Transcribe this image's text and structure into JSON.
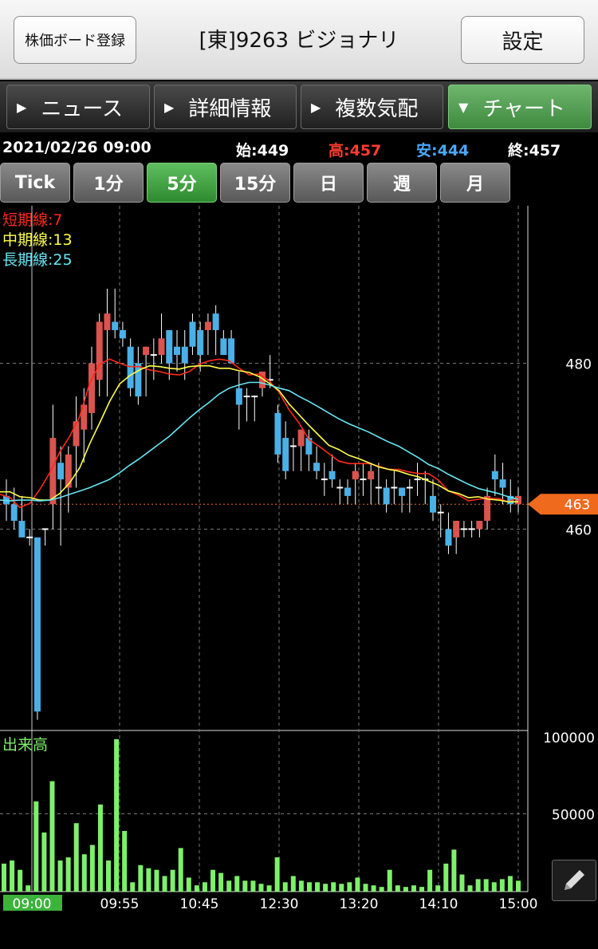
{
  "header": {
    "register_label": "株価ボード登録",
    "title": "[東]9263 ビジョナリ",
    "settings_label": "設定"
  },
  "nav": {
    "tabs": [
      {
        "label": "ニュース",
        "arrow": "▶",
        "active": false
      },
      {
        "label": "詳細情報",
        "arrow": "▶",
        "active": false
      },
      {
        "label": "複数気配",
        "arrow": "▶",
        "active": false
      },
      {
        "label": "チャート",
        "arrow": "▼",
        "active": true
      }
    ]
  },
  "info": {
    "datetime": "2021/02/26 09:00",
    "open": "始:449",
    "high": "高:457",
    "low": "安:444",
    "close": "終:457"
  },
  "periods": [
    {
      "label": "Tick",
      "active": false
    },
    {
      "label": "1分",
      "active": false
    },
    {
      "label": "5分",
      "active": true
    },
    {
      "label": "15分",
      "active": false
    },
    {
      "label": "日",
      "active": false
    },
    {
      "label": "週",
      "active": false
    },
    {
      "label": "月",
      "active": false
    }
  ],
  "colors": {
    "up": "#d9534f",
    "down": "#4ab0e6",
    "short_ma": "#ff2a1a",
    "mid_ma": "#ffff4a",
    "long_ma": "#66e6f2",
    "volume": "#7ef06a",
    "current_price_tag": "#f06a1e"
  },
  "chart": {
    "legend": {
      "short": "短期線:7",
      "mid": "中期線:13",
      "long": "長期線:25"
    },
    "volume_label": "出来高",
    "current_price": "463",
    "pencil_icon": "pencil-icon"
  },
  "chart_data": {
    "type": "candlestick",
    "price_axis": {
      "ticks": [
        480,
        460
      ],
      "range": [
        436,
        499
      ]
    },
    "volume_axis": {
      "ticks": [
        100000,
        50000
      ],
      "range": [
        0,
        100000
      ]
    },
    "time_labels": [
      "09:00",
      "09:55",
      "10:45",
      "12:30",
      "13:20",
      "14:10",
      "15:00"
    ],
    "series": [
      {
        "name": "短期線:7",
        "values": [
          464.2,
          463.8,
          462.6,
          463.1,
          464.8,
          466.8,
          469.3,
          471.2,
          473.6,
          477.6,
          479.9,
          480.5,
          480.0,
          479.6,
          479.6,
          479.2,
          479.0,
          478.7,
          478.6,
          479.0,
          479.9,
          480.3,
          480.5,
          480.3,
          479.4,
          478.6,
          478.7,
          477.9,
          476.5,
          474.4,
          472.8,
          470.8,
          470.0,
          469.1,
          468.2,
          467.9,
          467.9,
          467.9,
          467.6,
          467.2,
          467.2,
          466.9,
          466.7,
          466.7,
          465.9,
          464.6,
          464.1,
          463.4,
          463.6,
          463.7,
          463.7,
          463.3,
          463.8
        ]
      },
      {
        "name": "中期線:13",
        "values": [
          464.5,
          464.5,
          463.9,
          463.8,
          463.5,
          463.5,
          464.3,
          465.6,
          467.4,
          470.3,
          472.8,
          475.4,
          477.5,
          478.5,
          479.2,
          479.7,
          479.6,
          479.4,
          479.3,
          479.6,
          479.7,
          479.7,
          479.4,
          479.4,
          479.1,
          478.9,
          478.4,
          477.6,
          476.7,
          475.1,
          473.8,
          472.5,
          471.3,
          470.1,
          469.6,
          468.9,
          468.5,
          468.0,
          467.5,
          467.2,
          467.0,
          466.6,
          466.3,
          465.8,
          465.3,
          464.6,
          464.3,
          463.8,
          463.9,
          463.6,
          463.5,
          463.3,
          463.3
        ]
      },
      {
        "name": "長期線:25",
        "values": [
          463.5,
          463.4,
          463.5,
          463.5,
          463.4,
          463.5,
          463.8,
          464.2,
          464.6,
          465.0,
          465.5,
          466.0,
          466.8,
          467.7,
          468.5,
          469.4,
          470.3,
          471.2,
          472.3,
          473.4,
          474.4,
          475.3,
          476.3,
          477.0,
          477.4,
          477.7,
          477.7,
          477.4,
          477.0,
          476.7,
          476.0,
          475.4,
          474.7,
          474.0,
          473.3,
          472.7,
          472.2,
          471.7,
          471.1,
          470.5,
          470.0,
          469.3,
          468.6,
          467.8,
          467.3,
          466.6,
          466.0,
          465.4,
          464.9,
          464.6,
          464.3,
          463.9,
          463.6
        ]
      },
      {
        "name": "出来高",
        "values": [
          18000,
          20000,
          14000,
          4000,
          58000,
          38000,
          71000,
          20000,
          22000,
          44000,
          24000,
          30000,
          56000,
          20000,
          98000,
          39000,
          6000,
          17000,
          15000,
          14000,
          10000,
          14000,
          28000,
          9000,
          4000,
          6000,
          14000,
          12000,
          7000,
          10000,
          7000,
          7000,
          5000,
          4000,
          22000,
          6000,
          10000,
          7000,
          6000,
          6000,
          5000,
          6000,
          5000,
          6000,
          9000,
          5000,
          4000,
          3000,
          14000,
          4000,
          3000,
          4000,
          3000,
          14000,
          4000,
          18000,
          27000,
          11000,
          4000,
          8000,
          8000,
          6000,
          8000,
          10000,
          7000
        ]
      }
    ],
    "candles": [
      [
        464,
        466,
        461,
        463
      ],
      [
        463,
        465,
        460,
        461
      ],
      [
        461,
        464,
        459,
        459
      ],
      [
        459,
        460,
        458,
        459
      ],
      [
        459,
        459,
        437,
        438
      ],
      [
        460,
        460,
        458,
        460
      ],
      [
        463,
        475,
        460,
        471
      ],
      [
        468,
        470,
        458,
        466
      ],
      [
        465,
        470,
        462,
        469
      ],
      [
        470,
        476,
        465,
        473
      ],
      [
        472,
        477,
        468,
        475
      ],
      [
        474,
        482,
        472,
        480
      ],
      [
        478,
        486,
        476,
        485
      ],
      [
        484,
        489,
        476,
        486
      ],
      [
        485,
        489,
        483,
        484
      ],
      [
        484,
        485,
        482,
        483
      ],
      [
        482,
        483,
        476,
        477
      ],
      [
        480,
        482,
        475,
        476
      ],
      [
        481,
        482,
        476,
        482
      ],
      [
        481,
        483,
        478,
        481
      ],
      [
        481,
        486,
        480,
        483
      ],
      [
        484,
        484,
        478,
        480
      ],
      [
        482,
        484,
        479,
        481
      ],
      [
        482,
        484,
        478,
        480
      ],
      [
        485,
        486,
        481,
        482
      ],
      [
        484,
        485,
        479,
        481
      ],
      [
        484,
        486,
        481,
        485
      ],
      [
        486,
        487,
        481,
        484
      ],
      [
        483,
        484,
        481,
        481
      ],
      [
        483,
        484,
        481,
        480
      ],
      [
        477,
        479,
        472,
        475
      ],
      [
        476,
        477,
        473,
        476
      ],
      [
        476,
        476,
        473,
        476
      ],
      [
        477,
        479,
        476,
        479
      ],
      [
        478,
        481,
        477,
        478
      ],
      [
        474,
        475,
        468,
        469
      ],
      [
        471,
        473,
        466,
        467
      ],
      [
        470,
        471,
        467,
        470
      ],
      [
        470,
        472,
        467,
        472
      ],
      [
        471,
        472,
        467,
        469
      ],
      [
        468,
        470,
        466,
        467
      ],
      [
        466,
        468,
        464,
        466
      ],
      [
        467,
        469,
        465,
        466
      ],
      [
        465,
        466,
        463,
        465
      ],
      [
        465,
        466,
        463,
        464
      ],
      [
        466,
        468,
        463,
        467
      ],
      [
        466,
        468,
        464,
        466
      ],
      [
        466,
        468,
        463,
        467
      ],
      [
        465,
        468,
        463,
        465
      ],
      [
        465,
        466,
        462,
        463
      ],
      [
        465,
        467,
        463,
        465
      ],
      [
        465,
        465,
        462,
        464
      ],
      [
        465,
        466,
        462,
        465
      ],
      [
        466,
        468,
        464,
        466
      ],
      [
        466,
        467,
        463,
        466
      ],
      [
        464,
        466,
        461,
        462
      ],
      [
        462,
        463,
        459,
        462
      ],
      [
        460,
        462,
        457,
        458
      ],
      [
        459,
        461,
        457,
        461
      ],
      [
        460,
        461,
        459,
        460
      ],
      [
        460,
        461,
        459,
        460
      ],
      [
        460,
        461,
        459,
        461
      ],
      [
        461,
        465,
        460,
        464
      ],
      [
        467,
        469,
        464,
        466
      ],
      [
        466,
        468,
        463,
        465
      ],
      [
        464,
        466,
        462,
        463
      ],
      [
        463,
        465,
        462,
        464
      ]
    ]
  }
}
